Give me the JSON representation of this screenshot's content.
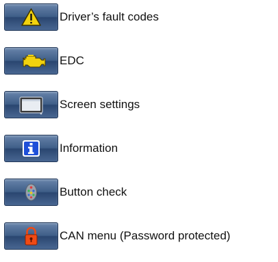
{
  "menu": {
    "items": [
      {
        "label": "Driver’s fault codes",
        "icon": "warning-icon"
      },
      {
        "label": "EDC",
        "icon": "engine-icon"
      },
      {
        "label": "Screen settings",
        "icon": "screen-icon"
      },
      {
        "label": "Information",
        "icon": "info-icon"
      },
      {
        "label": "Button check",
        "icon": "button-check-icon"
      },
      {
        "label": "CAN menu (Password protected)",
        "icon": "padlock-icon"
      }
    ]
  },
  "colors": {
    "tile": "#3f5e88",
    "warning": "#f2d20e",
    "engine": "#f2d20e",
    "info": "#1e4fd8",
    "padlock": "#f04a14"
  }
}
